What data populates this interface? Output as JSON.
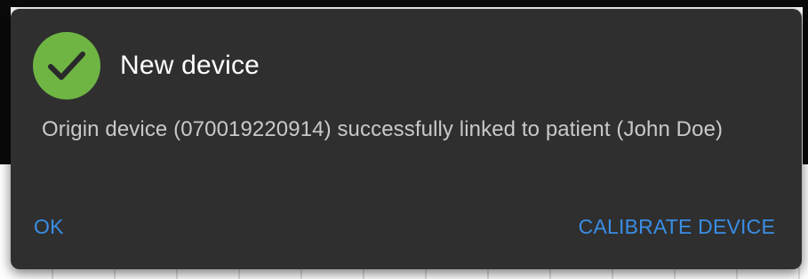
{
  "dialog": {
    "title": "New device",
    "message": "Origin device (070019220914) successfully linked to patient (John Doe)",
    "icon": "check-circle-icon",
    "actions": {
      "ok_label": "OK",
      "calibrate_label": "CALIBRATE DEVICE"
    }
  },
  "colors": {
    "dialog_background": "#2f2f2f",
    "success_green": "#6fb544",
    "action_blue": "#3a8ee6",
    "title_text": "#ffffff",
    "message_text": "#c9c9c9"
  }
}
